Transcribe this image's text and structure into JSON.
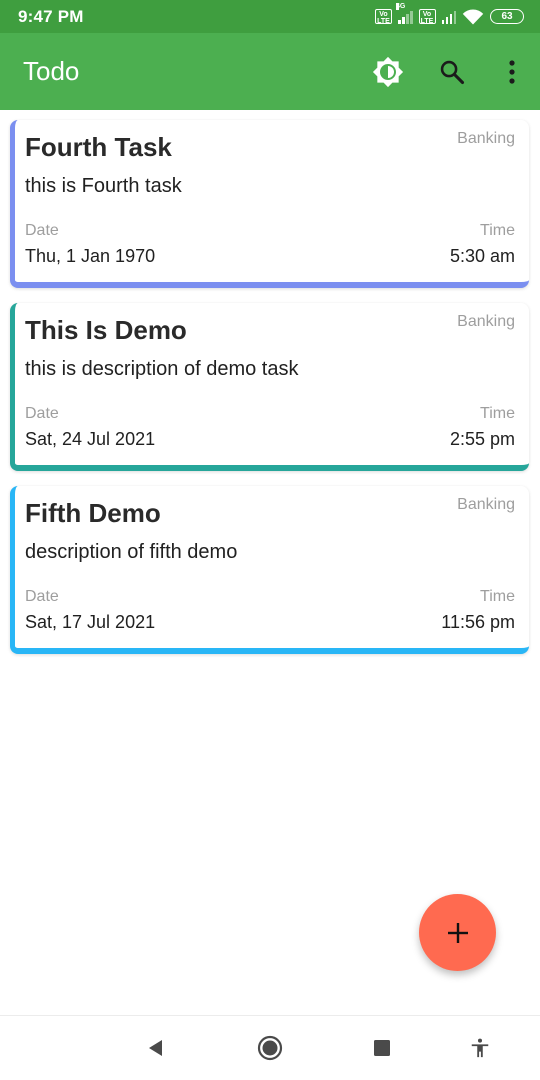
{
  "status_bar": {
    "time": "9:47 PM",
    "volte_label": "Vo LTE",
    "network_label": "4G",
    "battery": "63"
  },
  "app_bar": {
    "title": "Todo",
    "icons": [
      "brightness-icon",
      "search-icon",
      "more-vert-icon"
    ]
  },
  "labels": {
    "date": "Date",
    "time": "Time"
  },
  "tasks": [
    {
      "title": "Fourth Task",
      "category": "Banking",
      "description": "this is Fourth task",
      "date": "Thu, 1 Jan 1970",
      "time": "5:30 am",
      "color": "#7b8ff0"
    },
    {
      "title": "This Is Demo",
      "category": "Banking",
      "description": "this is description of demo task",
      "date": "Sat, 24 Jul 2021",
      "time": "2:55 pm",
      "color": "#26a69a"
    },
    {
      "title": "Fifth Demo",
      "category": "Banking",
      "description": "description of fifth demo",
      "date": "Sat, 17 Jul 2021",
      "time": "11:56 pm",
      "color": "#29b6f6"
    }
  ],
  "fab": {
    "icon": "add-icon",
    "color": "#ff6a50"
  },
  "nav_bar": {
    "icons": [
      "back-icon",
      "home-icon",
      "recents-icon",
      "accessibility-icon"
    ]
  },
  "colors": {
    "status_bar": "#3f9e3f",
    "app_bar": "#4caf50"
  }
}
